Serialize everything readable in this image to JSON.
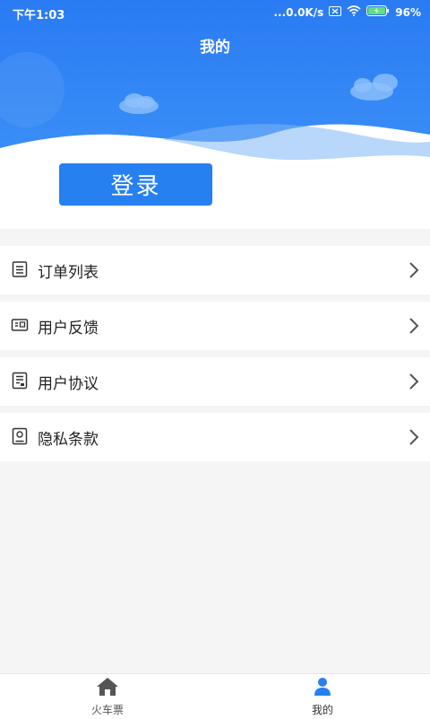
{
  "status_bar": {
    "time": "下午1:03",
    "network_speed": "...0.0K/s",
    "battery": "96%"
  },
  "header": {
    "title": "我的",
    "login_label": "登录"
  },
  "menu": [
    {
      "label": "订单列表",
      "icon": "list-icon"
    },
    {
      "label": "用户反馈",
      "icon": "feedback-icon"
    },
    {
      "label": "用户协议",
      "icon": "agreement-icon"
    },
    {
      "label": "隐私条款",
      "icon": "privacy-icon"
    }
  ],
  "tabs": [
    {
      "label": "火车票",
      "icon": "home-icon",
      "active": false
    },
    {
      "label": "我的",
      "icon": "person-icon",
      "active": true
    }
  ],
  "colors": {
    "primary": "#2780f0",
    "header_gradient_top": "#2a7bf3",
    "header_gradient_bottom": "#3c93f7"
  }
}
